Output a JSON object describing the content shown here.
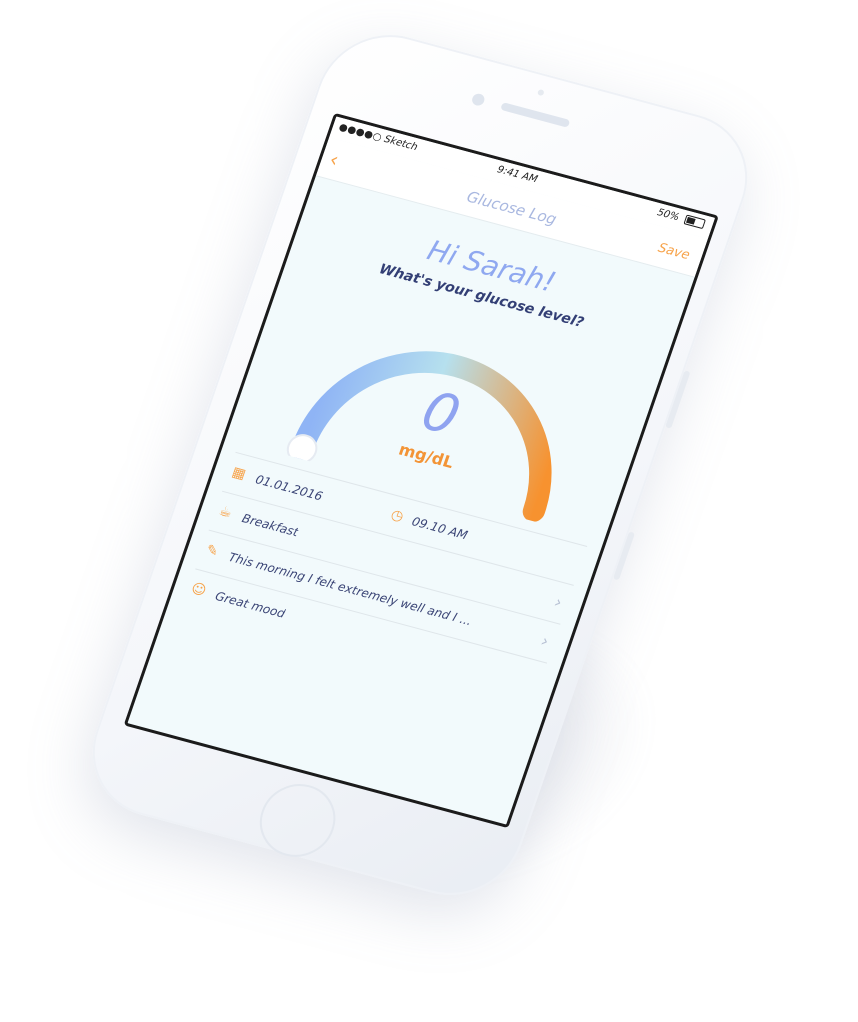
{
  "status_bar": {
    "carrier": "●●●●○ Sketch",
    "time": "9:41 AM",
    "battery": "50%"
  },
  "nav": {
    "title": "Glucose Log",
    "save_label": "Save",
    "back_icon": "chevron-left-icon"
  },
  "greeting": "Hi Sarah!",
  "question": "What's your glucose level?",
  "gauge": {
    "value": "0",
    "unit": "mg/dL",
    "level": 0,
    "colors": {
      "start": "#8fb4f5",
      "middle": "#b6e0ee",
      "end": "#f7922f"
    }
  },
  "rows": {
    "date": {
      "icon": "calendar-icon",
      "text": "01.01.2016"
    },
    "time": {
      "icon": "clock-icon",
      "text": "09.10 AM"
    },
    "meal": {
      "icon": "teapot-icon",
      "text": "Breakfast"
    },
    "note": {
      "icon": "note-icon",
      "text": "This morning I felt extremely well and I ..."
    },
    "mood": {
      "icon": "smiley-icon",
      "text": "Great mood"
    }
  },
  "accent_color": "#f7a34a"
}
